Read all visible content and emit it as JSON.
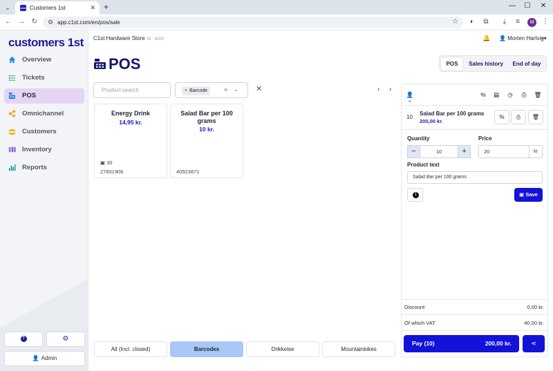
{
  "browser": {
    "tab_title": "Customers 1st",
    "tab_favicon_text": "c1st",
    "url": "app.c1st.com/en/pos/sale",
    "profile_initial": "M",
    "icons": [
      "tab-menu-icon",
      "close-icon",
      "plus-icon",
      "minimize-icon",
      "maximize-icon",
      "back-icon",
      "forward-icon",
      "reload-icon",
      "site-info-icon",
      "star-icon",
      "extension-icon",
      "download-icon",
      "media-icon",
      "more-icon"
    ]
  },
  "app": {
    "logo": "customers 1st",
    "store_name": "C1st Hardware Store",
    "store_id": "ID : 6200",
    "user_name": "Morten Hartvig"
  },
  "sidebar": {
    "items": [
      {
        "label": "Overview",
        "icon": "home-icon",
        "color": "#1e88e5"
      },
      {
        "label": "Tickets",
        "icon": "list-icon",
        "color": "#2e9d5b"
      },
      {
        "label": "POS",
        "icon": "cash-register-icon",
        "color": "#1e88e5"
      },
      {
        "label": "Omnichannel",
        "icon": "share-nodes-icon",
        "color": "#f59d0b"
      },
      {
        "label": "Customers",
        "icon": "users-icon",
        "color": "#f3b100"
      },
      {
        "label": "Inventory",
        "icon": "barcode-icon",
        "color": "#7b4fcf"
      },
      {
        "label": "Reports",
        "icon": "bar-chart-icon",
        "color": "#1c9a96"
      }
    ],
    "active_index": 2,
    "help_icon": "question-icon",
    "settings_icon": "gear-icon",
    "admin_label": "Admin"
  },
  "page": {
    "title": "POS",
    "view_tabs": [
      "POS",
      "Sales history",
      "End of day"
    ],
    "active_view": 0
  },
  "search": {
    "placeholder": "Product search",
    "filter_chip": "Barcode"
  },
  "products": [
    {
      "name": "Energy Drink",
      "price": "14,95 kr.",
      "stock": "30",
      "barcode": "27831906"
    },
    {
      "name": "Salad Bar per 100 grams",
      "price": "10 kr.",
      "stock": "",
      "barcode": "40923871"
    }
  ],
  "categories": [
    "All (Incl. closed)",
    "Barcodes",
    "Drikkelse",
    "Mountainbikes"
  ],
  "active_category": 1,
  "cart": {
    "line": {
      "qty": "10",
      "name": "Salad Bar per 100 grams",
      "total": "200,00 kr."
    },
    "quantity_label": "Quantity",
    "quantity_value": "10",
    "price_label": "Price",
    "price_value": "20",
    "price_unit": "kr",
    "product_text_label": "Product text",
    "product_text_value": "Salad Bar per 100 grams",
    "save_label": "Save",
    "discount_label": "Discount",
    "discount_value": "0,00 kr.",
    "vat_label": "Of which VAT",
    "vat_value": "40,00 kr."
  },
  "pay": {
    "label": "Pay (10)",
    "amount": "200,00 kr."
  },
  "colors": {
    "brand": "#1b1b9a",
    "primary_button": "#1212d8",
    "active_nav": "#e7d4f5",
    "active_category": "#a9c8f5"
  }
}
